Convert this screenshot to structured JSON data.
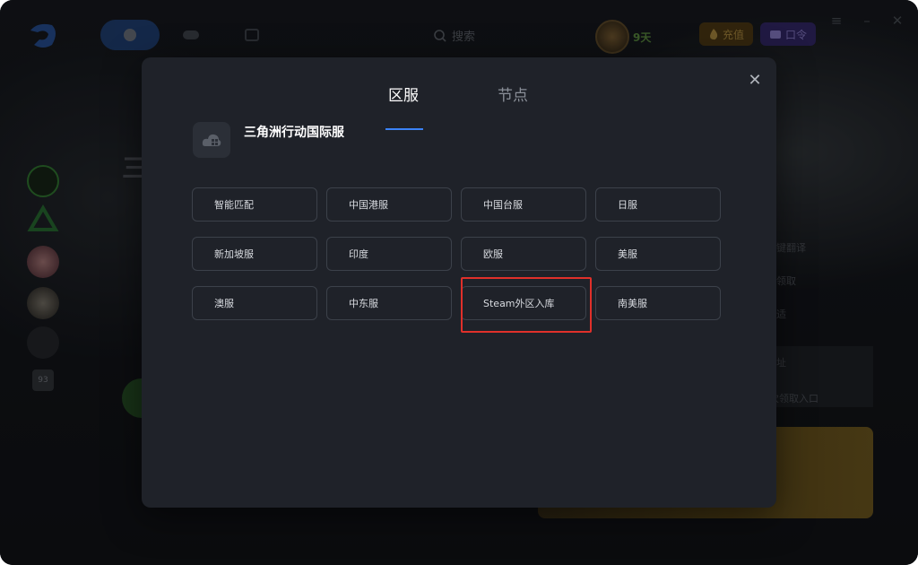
{
  "topbar": {
    "search_label": "搜索",
    "rank_days": "9天",
    "recharge_label": "充值",
    "code_label": "口令"
  },
  "background": {
    "big_char": "三",
    "side_texts": [
      "键翻译",
      "领取",
      "适",
      "址",
      "次领取入口"
    ],
    "sidebar_badge": "93"
  },
  "modal": {
    "tabs": [
      {
        "label": "区服",
        "active": true
      },
      {
        "label": "节点",
        "active": false
      }
    ],
    "game_name": "三角洲行动国际服",
    "regions": [
      "智能匹配",
      "中国港服",
      "中国台服",
      "日服",
      "新加坡服",
      "印度",
      "欧服",
      "美服",
      "澳服",
      "中东服",
      "Steam外区入库",
      "南美服"
    ],
    "highlighted_region": "Steam外区入库"
  },
  "colors": {
    "accent": "#3b82f6",
    "highlight_border": "#e0302a",
    "modal_bg": "#1f2229",
    "button_border": "#3c414a"
  },
  "icons": [
    "logo-icon",
    "home-icon",
    "gamepad-icon",
    "gallery-icon",
    "search-icon",
    "rank-badge-icon",
    "fire-icon",
    "gift-icon",
    "menu-icon",
    "minimize-icon",
    "close-icon",
    "cloud-grid-icon"
  ]
}
